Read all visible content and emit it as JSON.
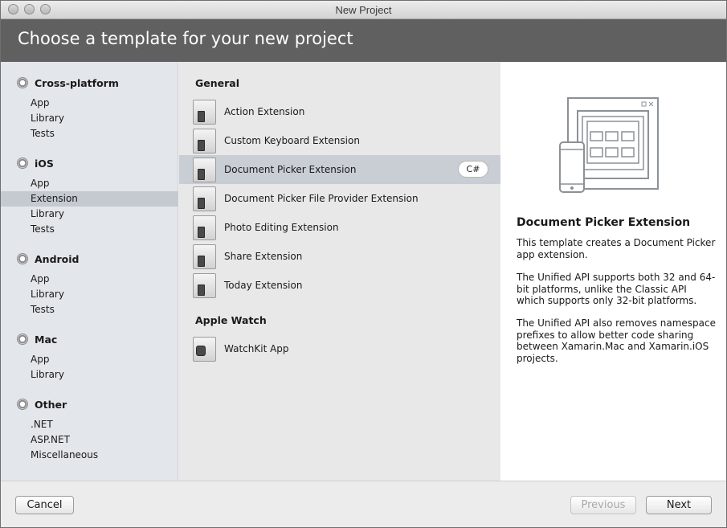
{
  "window": {
    "title": "New Project"
  },
  "header": {
    "title": "Choose a template for your new project"
  },
  "sidebar": {
    "groups": [
      {
        "label": "Cross-platform",
        "items": [
          "App",
          "Library",
          "Tests"
        ]
      },
      {
        "label": "iOS",
        "items": [
          "App",
          "Extension",
          "Library",
          "Tests"
        ]
      },
      {
        "label": "Android",
        "items": [
          "App",
          "Library",
          "Tests"
        ]
      },
      {
        "label": "Mac",
        "items": [
          "App",
          "Library"
        ]
      },
      {
        "label": "Other",
        "items": [
          ".NET",
          "ASP.NET",
          "Miscellaneous"
        ]
      }
    ],
    "selected": "Extension"
  },
  "templates": {
    "sections": [
      {
        "label": "General",
        "items": [
          "Action Extension",
          "Custom Keyboard Extension",
          "Document Picker Extension",
          "Document Picker File Provider Extension",
          "Photo Editing Extension",
          "Share Extension",
          "Today Extension"
        ]
      },
      {
        "label": "Apple Watch",
        "items": [
          "WatchKit App"
        ]
      }
    ],
    "selected": "Document Picker Extension",
    "selected_language": "C#"
  },
  "description": {
    "title": "Document Picker Extension",
    "paragraphs": [
      "This template creates a Document Picker app extension.",
      "The Unified API supports both 32 and 64-bit platforms, unlike the Classic API which supports only 32-bit platforms.",
      "The Unified API also removes namespace prefixes to allow better code sharing between Xamarin.Mac and Xamarin.iOS projects."
    ]
  },
  "footer": {
    "cancel": "Cancel",
    "previous": "Previous",
    "next": "Next"
  }
}
